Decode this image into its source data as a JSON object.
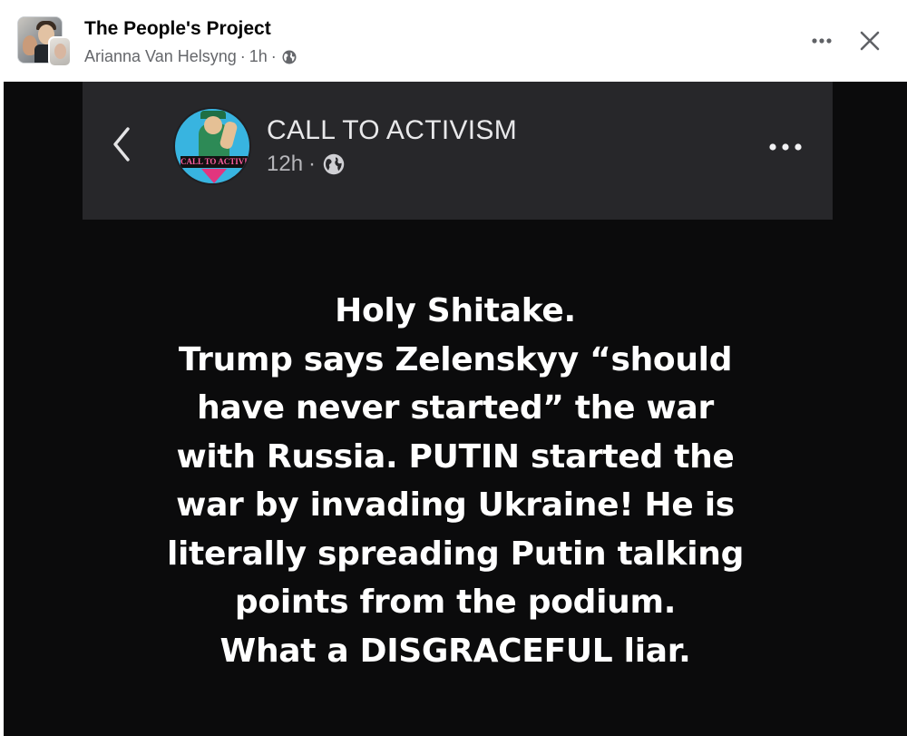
{
  "header": {
    "group_name": "The People's Project",
    "author": "Arianna Van Helsyng",
    "separator": "·",
    "time": "1h",
    "privacy_icon": "globe-icon",
    "more_icon": "more-horizontal-icon",
    "close_icon": "close-icon"
  },
  "shared_post": {
    "back_icon": "chevron-left-icon",
    "page_name": "CALL TO ACTIVISM",
    "avatar_banner": "CALL TO ACTIVISM",
    "time": "12h",
    "separator": "·",
    "privacy_icon": "globe-icon",
    "more_icon": "more-horizontal-icon",
    "text_lines": [
      "Holy Shitake.",
      "Trump says Zelenskyy “should",
      "have never started” the war",
      "with Russia.  PUTIN started the",
      "war by invading Ukraine! He is",
      "literally spreading Putin talking",
      "points from the podium.",
      "What a DISGRACEFUL liar."
    ]
  },
  "colors": {
    "image_background": "#0b0b0c",
    "embedded_header_background": "#27272a",
    "text_primary": "#050505",
    "text_secondary": "#65676b"
  }
}
